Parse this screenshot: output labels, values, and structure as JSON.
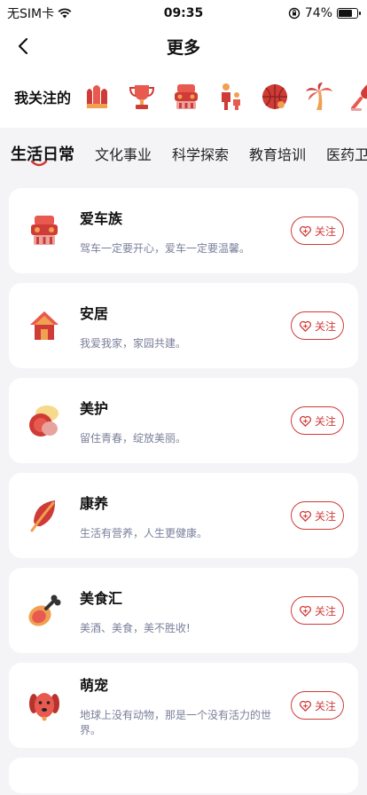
{
  "status_bar": {
    "carrier": "无SIM卡",
    "time": "09:35",
    "battery": "74%",
    "battery_level": 0.74
  },
  "header": {
    "title": "更多",
    "back_icon": "chevron-left-icon"
  },
  "following": {
    "label": "我关注的",
    "icons": [
      "fries-icon",
      "trophy-icon",
      "car-icon",
      "family-icon",
      "basketball-icon",
      "palm-tree-icon",
      "microphone-icon"
    ]
  },
  "tabs": [
    {
      "label": "生活日常",
      "active": true
    },
    {
      "label": "文化事业",
      "active": false
    },
    {
      "label": "科学探索",
      "active": false
    },
    {
      "label": "教育培训",
      "active": false
    },
    {
      "label": "医药卫生",
      "active": false
    }
  ],
  "cards": [
    {
      "name": "爱车族",
      "desc": "驾车一定要开心，爱车一定要温馨。",
      "icon": "car-icon",
      "follow_label": "关注"
    },
    {
      "name": "安居",
      "desc": "我爱我家，家园共建。",
      "icon": "house-icon",
      "follow_label": "关注"
    },
    {
      "name": "美护",
      "desc": "留住青春，绽放美丽。",
      "icon": "cosmetics-icon",
      "follow_label": "关注"
    },
    {
      "name": "康养",
      "desc": "生活有营养，人生更健康。",
      "icon": "leaf-icon",
      "follow_label": "关注"
    },
    {
      "name": "美食汇",
      "desc": "美酒、美食，美不胜收!",
      "icon": "meat-leg-icon",
      "follow_label": "关注"
    },
    {
      "name": "萌宠",
      "desc": "地球上没有动物，那是一个没有活力的世界。",
      "icon": "dog-icon",
      "follow_label": "关注"
    }
  ],
  "colors": {
    "accent": "#cf3b36",
    "icon_orange": "#f0a050",
    "background": "#f4f4f6"
  }
}
